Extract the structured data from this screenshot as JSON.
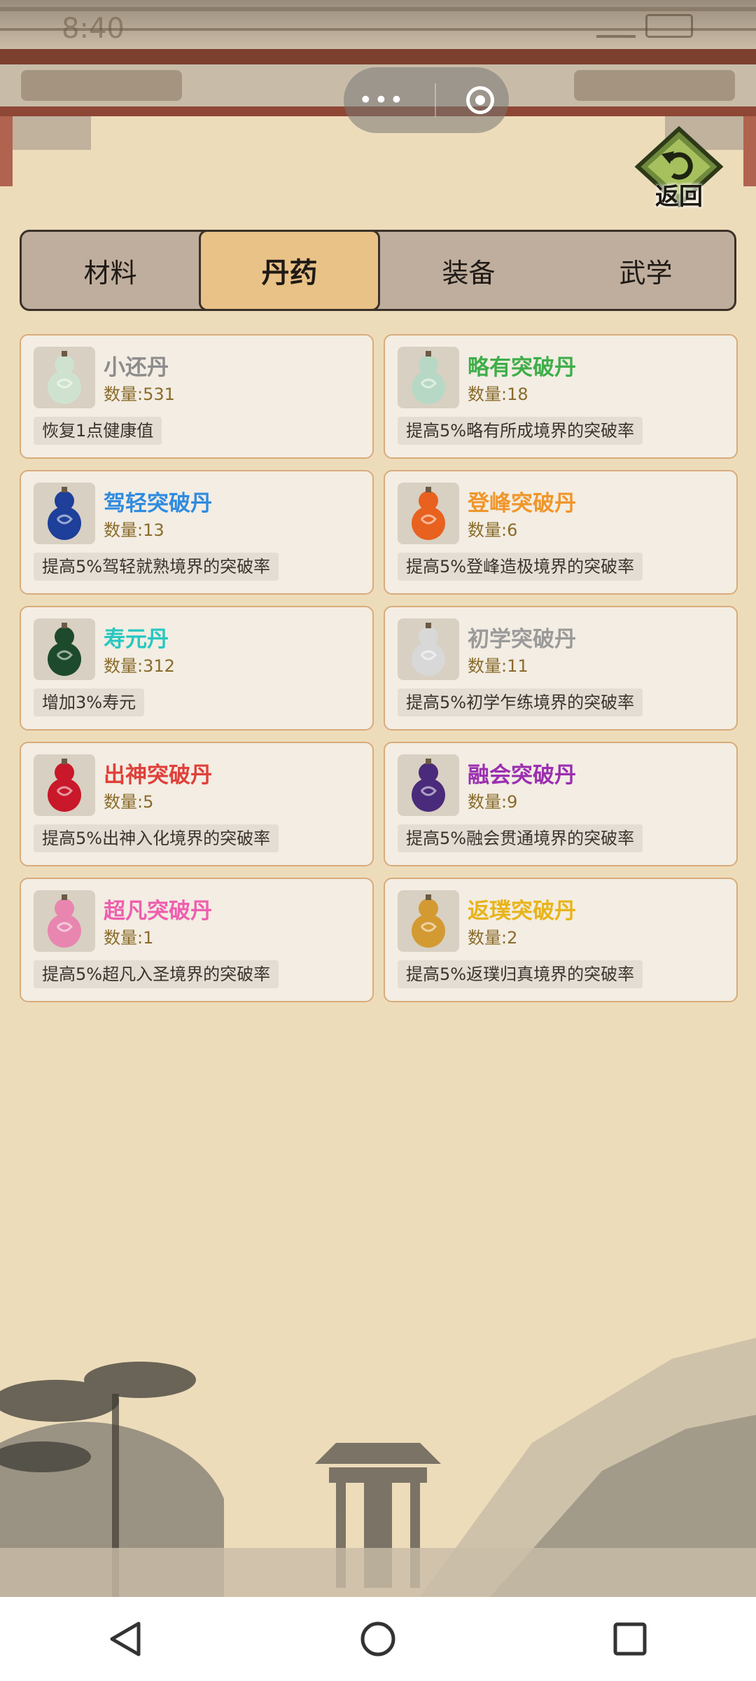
{
  "status": {
    "time": "8:40"
  },
  "header": {
    "back_label": "返回"
  },
  "tabs": [
    {
      "label": "材料",
      "active": false
    },
    {
      "label": "丹药",
      "active": true
    },
    {
      "label": "装备",
      "active": false
    },
    {
      "label": "武学",
      "active": false
    }
  ],
  "items": [
    {
      "name": "小还丹",
      "qty": "数量:531",
      "desc": "恢复1点健康值",
      "color": "#8c8c8c",
      "pill_color": "#cfe2cf"
    },
    {
      "name": "略有突破丹",
      "qty": "数量:18",
      "desc": "提高5%略有所成境界的突破率",
      "color": "#3fae4a",
      "pill_color": "#b7d8c4"
    },
    {
      "name": "驾轻突破丹",
      "qty": "数量:13",
      "desc": "提高5%驾轻就熟境界的突破率",
      "color": "#2f8be0",
      "pill_color": "#1e3f9a"
    },
    {
      "name": "登峰突破丹",
      "qty": "数量:6",
      "desc": "提高5%登峰造极境界的突破率",
      "color": "#f0962a",
      "pill_color": "#e8611e"
    },
    {
      "name": "寿元丹",
      "qty": "数量:312",
      "desc": "增加3%寿元",
      "color": "#26c8c0",
      "pill_color": "#1d4a2c"
    },
    {
      "name": "初学突破丹",
      "qty": "数量:11",
      "desc": "提高5%初学乍练境界的突破率",
      "color": "#9a9a9a",
      "pill_color": "#d8d8d8"
    },
    {
      "name": "出神突破丹",
      "qty": "数量:5",
      "desc": "提高5%出神入化境界的突破率",
      "color": "#e0403a",
      "pill_color": "#c8182a"
    },
    {
      "name": "融会突破丹",
      "qty": "数量:9",
      "desc": "提高5%融会贯通境界的突破率",
      "color": "#9b2fb0",
      "pill_color": "#4a2a7a"
    },
    {
      "name": "超凡突破丹",
      "qty": "数量:1",
      "desc": "提高5%超凡入圣境界的突破率",
      "color": "#ee5fae",
      "pill_color": "#e886b0"
    },
    {
      "name": "返璞突破丹",
      "qty": "数量:2",
      "desc": "提高5%返璞归真境界的突破率",
      "color": "#e8b41a",
      "pill_color": "#d49a32"
    }
  ]
}
